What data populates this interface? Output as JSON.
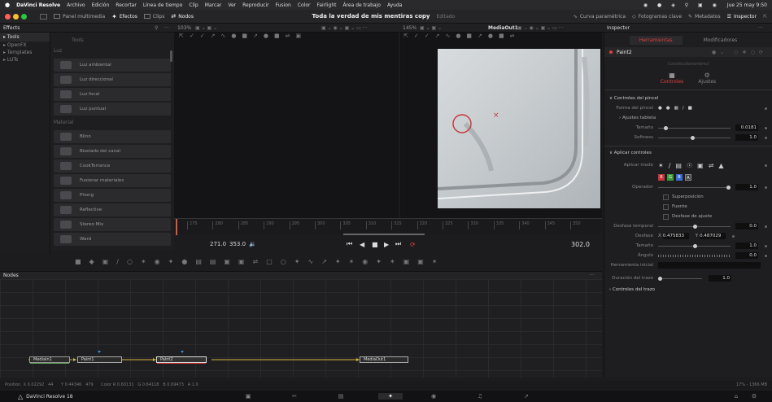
{
  "menubar": {
    "apple": "",
    "app_name": "DaVinci Resolve",
    "items": [
      "Archivo",
      "Edición",
      "Recortar",
      "Línea de tiempo",
      "Clip",
      "Marcar",
      "Ver",
      "Reproducir",
      "Fusion",
      "Color",
      "Fairlight",
      "Área de trabajo",
      "Ayuda"
    ],
    "datetime": "Jue 25 may 9:50"
  },
  "titlebar": {
    "media_pool": "Panel multimedia",
    "effects": "Efectos",
    "clips": "Clips",
    "nodes": "Nodos",
    "project_title": "Toda la verdad de mis mentiras copy",
    "project_status": "Editado",
    "spline": "Curva paramétrica",
    "keyframes": "Fotogramas clave",
    "metadata": "Metadatos",
    "inspector": "Inspector"
  },
  "panels_bar": {
    "effects": "Effects",
    "left_zoom": "103%",
    "right_zoom": "145%",
    "viewer_name": "MediaOut1",
    "inspector": "Inspector"
  },
  "effects_tree": [
    "Tools",
    "OpenFX",
    "Templates",
    "LUTs"
  ],
  "tools_panel": {
    "header": "Tools",
    "section_light": "Luz",
    "lights": [
      "Luz ambiental",
      "Luz direccional",
      "Luz focal",
      "Luz puntual"
    ],
    "section_material": "Material",
    "materials": [
      "Blinn",
      "Biselado del canal",
      "CookTorrance",
      "Fusionar materiales",
      "Phong",
      "Reflective",
      "Stereo Mix",
      "Ward"
    ]
  },
  "timeline_ruler": [
    "275",
    "280",
    "285",
    "290",
    "295",
    "300",
    "305",
    "310",
    "315",
    "320",
    "325",
    "330",
    "335",
    "340",
    "345",
    "350"
  ],
  "transport": {
    "in_frame": "271.0",
    "out_frame": "353.0",
    "current_frame": "302.0"
  },
  "inspector": {
    "tab_tools": "Herramientas",
    "tab_modifiers": "Modificadores",
    "node_name": "Paint2",
    "placeholder": "Constituidonombre2",
    "tab_controls": "Controles",
    "tab_settings": "Ajustes",
    "section_brush": "Controles del pincel",
    "brush_shape_label": "Forma del pincel",
    "tablet_label": "Ajustes tableta",
    "size_label": "Tamaño",
    "size_value": "0.0181",
    "size_fraction": 0.08,
    "softness_label": "Softness",
    "softness_value": "1.0",
    "softness_fraction": 0.45,
    "section_apply": "Aplicar controles",
    "apply_mode_label": "Aplicar modo",
    "operator_label": "Operador",
    "channel_buttons": [
      "R",
      "G",
      "B",
      "A"
    ],
    "channel_value": "1.0",
    "check_overlay": "Superposición",
    "check_source": "Fuente",
    "check_alignment": "Desfase de ajuste",
    "time_offset_label": "Desfase temporal",
    "time_offset_value": "0.0",
    "offset_label": "Desfase",
    "offset_x_label": "X",
    "offset_x": "0.475833",
    "offset_y_label": "Y",
    "offset_y": "0.487029",
    "size2_label": "Tamaño",
    "size2_value": "1.0",
    "angle_label": "Ángulo",
    "angle_value": "0.0",
    "initial_tool_label": "Herramienta inicial",
    "stroke_duration_label": "Duración del trazo",
    "stroke_duration_value": "1.0",
    "stroke_controls_label": "Controles del trazo"
  },
  "nodes_panel": {
    "title": "Nodes",
    "nodes": [
      "MediaIn1",
      "Paint1",
      "Paint2",
      "MediaOut1"
    ]
  },
  "statusbar": {
    "position": "Position  X 0.02292   44      Y 0.44346   479      Color R 0.60131   G 0.64118   B 0.69473   A 1.0",
    "memory": "17% - 1366 MB"
  },
  "dock": {
    "app": "DaVinci Resolve 18"
  },
  "colors": {
    "accent_red": "#e0403a",
    "node_selected": "#c8343a",
    "node_connection": "#d4b43a",
    "viewer_bg": "#141416"
  }
}
